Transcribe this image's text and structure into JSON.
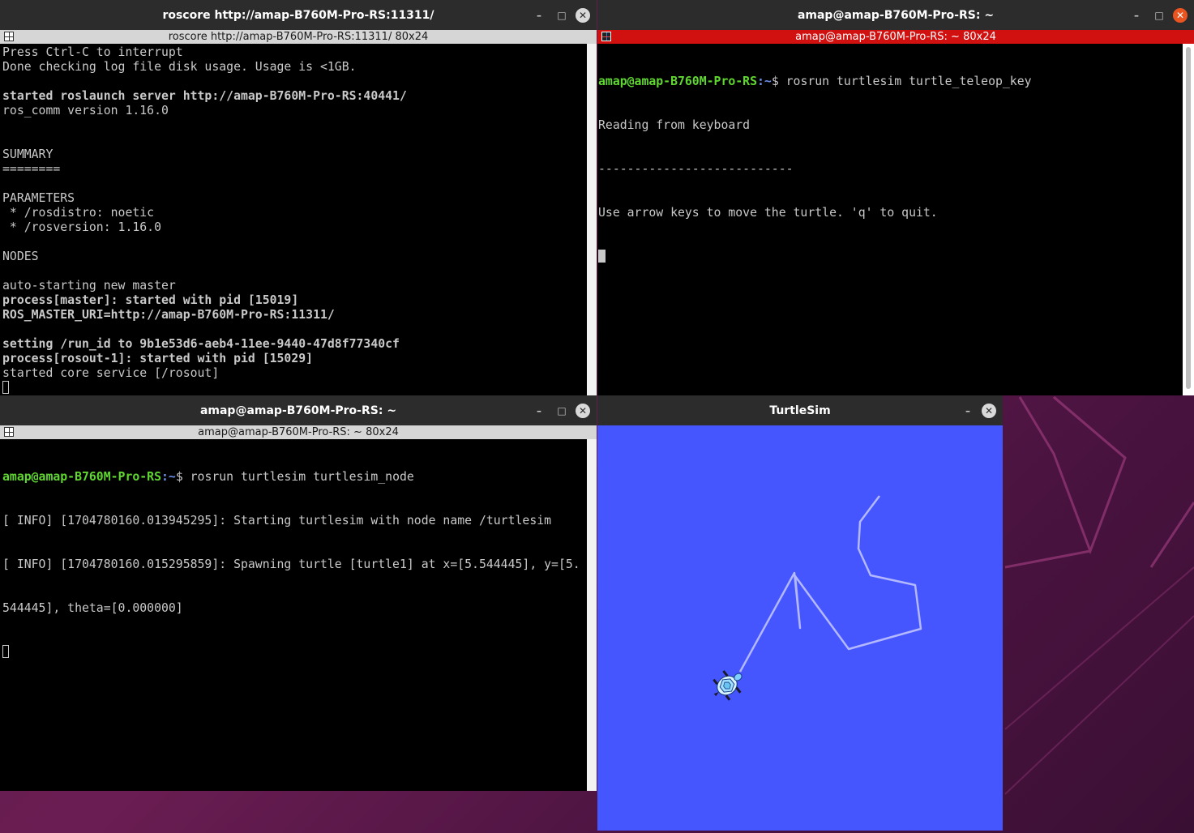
{
  "desktop": {
    "wallpaper": "Ubuntu purple gradient"
  },
  "windows": {
    "roscore": {
      "title": "roscore http://amap-B760M-Pro-RS:11311/",
      "tab": "roscore http://amap-B760M-Pro-RS:11311/ 80x24",
      "lines": [
        {
          "text": "Press Ctrl-C to interrupt",
          "bold": false
        },
        {
          "text": "Done checking log file disk usage. Usage is <1GB.",
          "bold": false
        },
        {
          "text": "",
          "bold": false
        },
        {
          "text": "started roslaunch server http://amap-B760M-Pro-RS:40441/",
          "bold": true
        },
        {
          "text": "ros_comm version 1.16.0",
          "bold": false
        },
        {
          "text": "",
          "bold": false
        },
        {
          "text": "",
          "bold": false
        },
        {
          "text": "SUMMARY",
          "bold": false
        },
        {
          "text": "========",
          "bold": false
        },
        {
          "text": "",
          "bold": false
        },
        {
          "text": "PARAMETERS",
          "bold": false
        },
        {
          "text": " * /rosdistro: noetic",
          "bold": false
        },
        {
          "text": " * /rosversion: 1.16.0",
          "bold": false
        },
        {
          "text": "",
          "bold": false
        },
        {
          "text": "NODES",
          "bold": false
        },
        {
          "text": "",
          "bold": false
        },
        {
          "text": "auto-starting new master",
          "bold": false
        },
        {
          "text": "process[master]: started with pid [15019]",
          "bold": true
        },
        {
          "text": "ROS_MASTER_URI=http://amap-B760M-Pro-RS:11311/",
          "bold": true
        },
        {
          "text": "",
          "bold": false
        },
        {
          "text": "setting /run_id to 9b1e53d6-aeb4-11ee-9440-47d8f77340cf",
          "bold": true
        },
        {
          "text": "process[rosout-1]: started with pid [15029]",
          "bold": true
        },
        {
          "text": "started core service [/rosout]",
          "bold": false
        }
      ]
    },
    "teleop": {
      "title": "amap@amap-B760M-Pro-RS: ~",
      "tab": "amap@amap-B760M-Pro-RS: ~ 80x24",
      "prompt_user": "amap@amap-B760M-Pro-RS",
      "prompt_path": ":~",
      "prompt_cmd": "$ rosrun turtlesim turtle_teleop_key",
      "lines": [
        "Reading from keyboard",
        "---------------------------",
        "Use arrow keys to move the turtle. 'q' to quit."
      ]
    },
    "turtlesim_node": {
      "title": "amap@amap-B760M-Pro-RS: ~",
      "tab": "amap@amap-B760M-Pro-RS: ~ 80x24",
      "prompt_user": "amap@amap-B760M-Pro-RS",
      "prompt_path": ":~",
      "prompt_cmd": "$ rosrun turtlesim turtlesim_node",
      "lines": [
        "[ INFO] [1704780160.013945295]: Starting turtlesim with node name /turtlesim",
        "[ INFO] [1704780160.015295859]: Spawning turtle [turtle1] at x=[5.544445], y=[5.",
        "544445], theta=[0.000000]"
      ]
    },
    "turtlesim": {
      "title": "TurtleSim",
      "background_color": "#4556ff",
      "pen_color": "#b3b8ff"
    }
  },
  "icons": {
    "minimize": "minimize-icon",
    "maximize": "maximize-icon",
    "close": "close-icon"
  },
  "glyphs": {
    "minimize": "–",
    "maximize": "□",
    "close": "✕"
  }
}
